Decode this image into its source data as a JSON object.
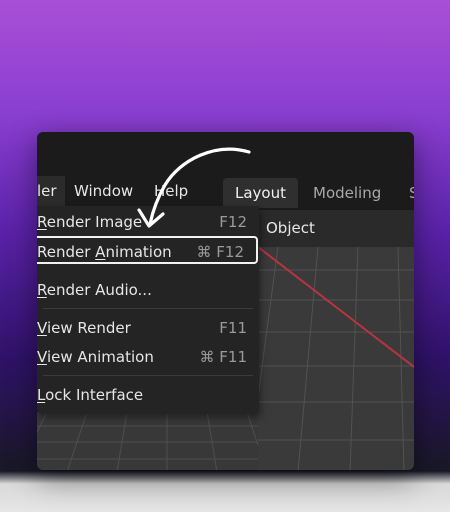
{
  "menubar": {
    "items": [
      {
        "label": "ler"
      },
      {
        "label": "Window"
      },
      {
        "label": "Help"
      }
    ]
  },
  "workspaces": {
    "tabs": [
      {
        "label": "Layout",
        "active": true
      },
      {
        "label": "Modeling"
      },
      {
        "label": "S"
      }
    ]
  },
  "viewport": {
    "header_label": "Object"
  },
  "render_menu": {
    "items": [
      {
        "pre": "",
        "mnemonic": "R",
        "post": "ender Image",
        "shortcut": "F12"
      },
      {
        "pre": "Render ",
        "mnemonic": "A",
        "post": "nimation",
        "shortcut": "⌘ F12",
        "highlighted": true
      },
      {
        "pre": "",
        "mnemonic": "R",
        "post": "ender Audio...",
        "shortcut": ""
      },
      {
        "pre": "",
        "mnemonic": "V",
        "post": "iew Render",
        "shortcut": "F11"
      },
      {
        "pre": "",
        "mnemonic": "V",
        "post": "iew Animation",
        "shortcut": "⌘ F11"
      },
      {
        "pre": "",
        "mnemonic": "L",
        "post": "ock Interface",
        "shortcut": ""
      }
    ]
  },
  "colors": {
    "background_top": "#a94fd6",
    "background_bottom": "#181826",
    "window_bg": "#1b1b1b",
    "menu_bg": "#242424",
    "grid_line": "#555555",
    "axis_red": "#b8343f",
    "highlight_border": "#f2f2f2"
  }
}
